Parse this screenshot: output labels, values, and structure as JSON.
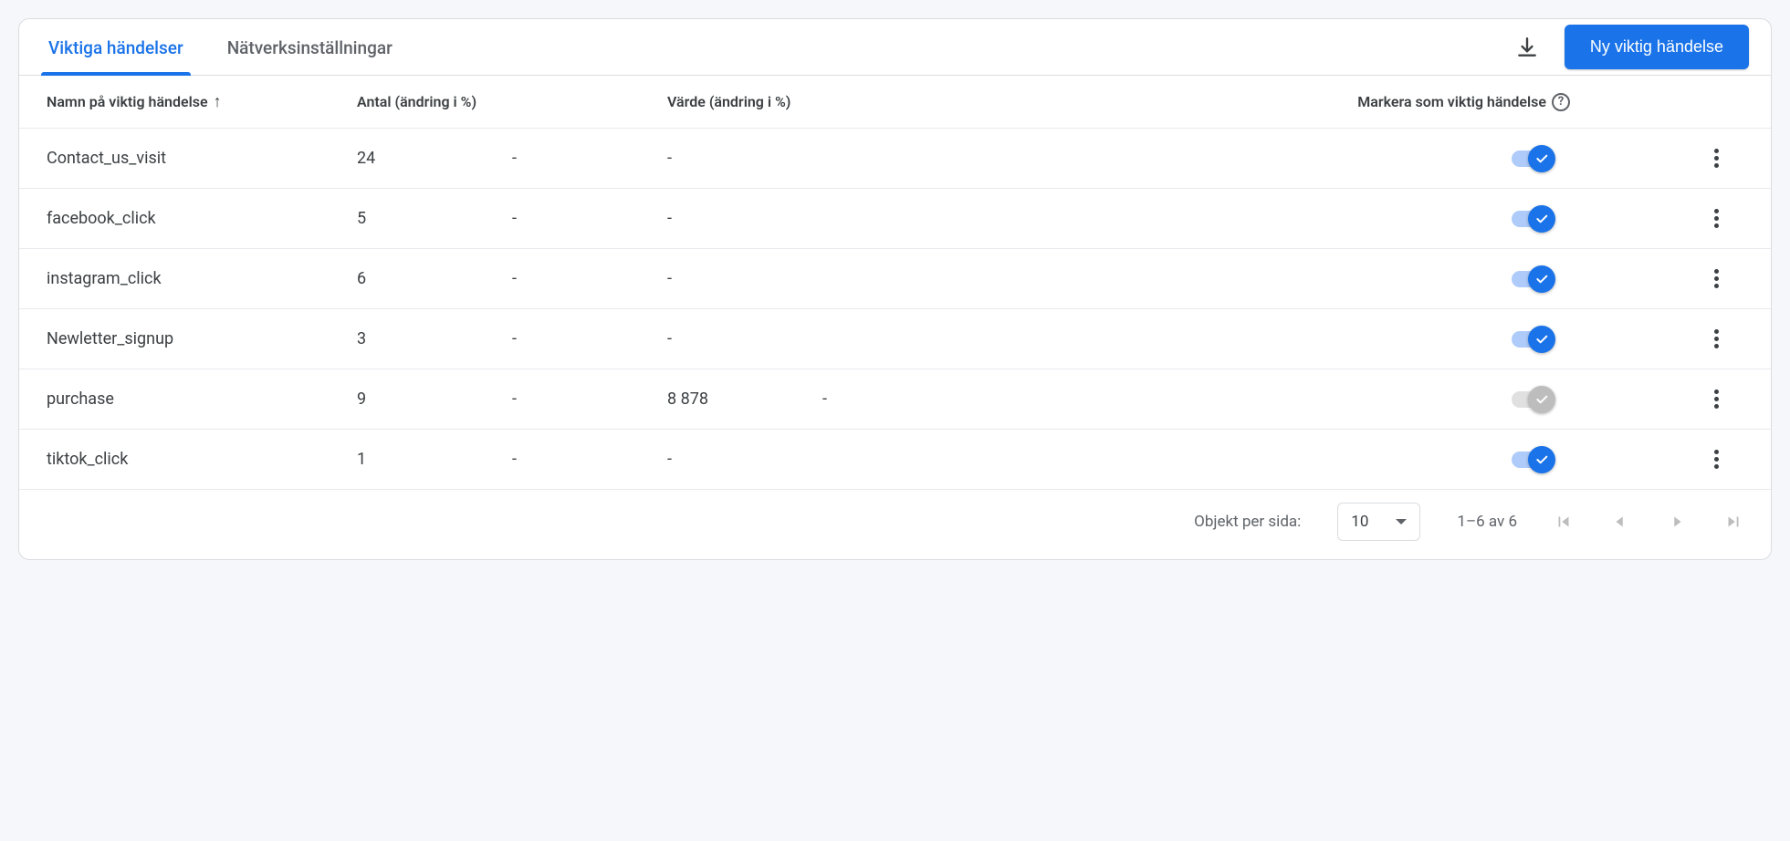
{
  "tabs": {
    "active_label": "Viktiga händelser",
    "network_label": "Nätverksinställningar"
  },
  "actions": {
    "new_event_label": "Ny viktig händelse"
  },
  "columns": {
    "name": "Namn på viktig händelse",
    "count": "Antal (ändring i %)",
    "value": "Värde (ändring i %)",
    "mark": "Markera som viktig händelse"
  },
  "rows": [
    {
      "name": "Contact_us_visit",
      "count": "24",
      "change1": "-",
      "value": "-",
      "change2": "",
      "marked": true
    },
    {
      "name": "facebook_click",
      "count": "5",
      "change1": "-",
      "value": "-",
      "change2": "",
      "marked": true
    },
    {
      "name": "instagram_click",
      "count": "6",
      "change1": "-",
      "value": "-",
      "change2": "",
      "marked": true
    },
    {
      "name": "Newletter_signup",
      "count": "3",
      "change1": "-",
      "value": "-",
      "change2": "",
      "marked": true
    },
    {
      "name": "purchase",
      "count": "9",
      "change1": "-",
      "value": "8 878",
      "change2": "-",
      "marked": false
    },
    {
      "name": "tiktok_click",
      "count": "1",
      "change1": "-",
      "value": "-",
      "change2": "",
      "marked": true
    }
  ],
  "pagination": {
    "label": "Objekt per sida:",
    "per_page": "10",
    "range": "1–6 av 6"
  }
}
